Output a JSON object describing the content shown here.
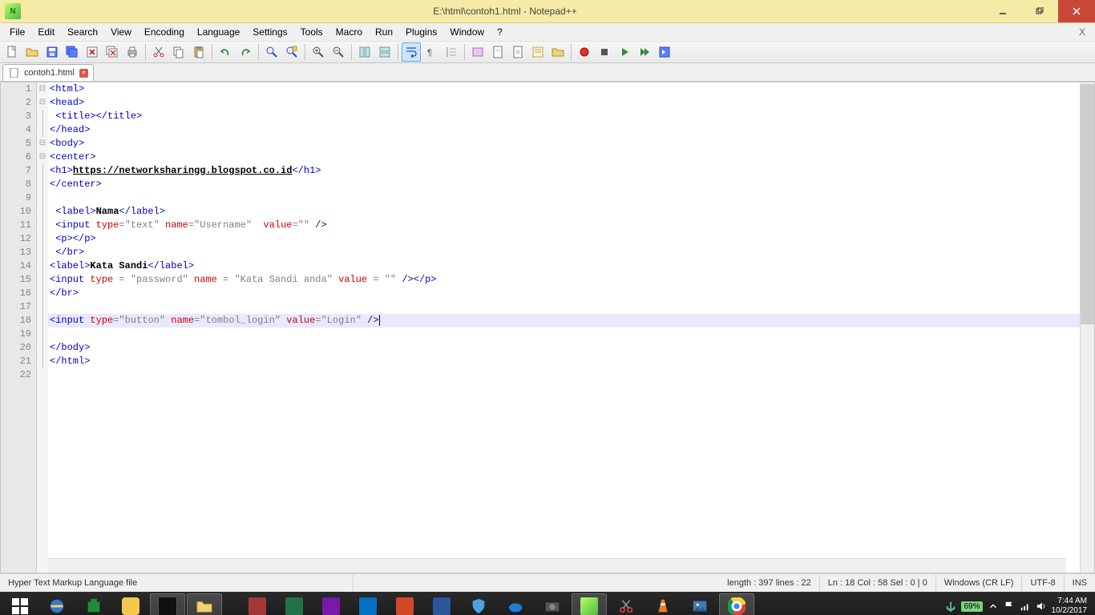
{
  "window": {
    "title": "E:\\html\\contoh1.html - Notepad++",
    "menu": [
      "File",
      "Edit",
      "Search",
      "View",
      "Encoding",
      "Language",
      "Settings",
      "Tools",
      "Macro",
      "Run",
      "Plugins",
      "Window",
      "?"
    ],
    "menu_close": "X"
  },
  "tab": {
    "label": "contoh1.html"
  },
  "lines": {
    "n1": "1",
    "n2": "2",
    "n3": "3",
    "n4": "4",
    "n5": "5",
    "n6": "6",
    "n7": "7",
    "n8": "8",
    "n9": "9",
    "n10": "10",
    "n11": "11",
    "n12": "12",
    "n13": "13",
    "n14": "14",
    "n15": "15",
    "n16": "16",
    "n17": "17",
    "n18": "18",
    "n19": "19",
    "n20": "20",
    "n21": "21",
    "n22": "22"
  },
  "code": {
    "l1": {
      "a": "<html>"
    },
    "l2": {
      "a": "<head>"
    },
    "l3": {
      "a": " <title>",
      "b": "</title>"
    },
    "l4": {
      "a": "</head>"
    },
    "l5": {
      "a": "<body>"
    },
    "l6": {
      "a": "<center>"
    },
    "l7": {
      "a": "<h1>",
      "b": "https://networksharingg.blogspot.co.id",
      "c": "</h1>"
    },
    "l8": {
      "a": "</center>"
    },
    "l10": {
      "a": " <label>",
      "b": "Nama",
      "c": "</label>"
    },
    "l11": {
      "a": " <input ",
      "b": "type",
      "c": "=\"text\"",
      "d": " name",
      "e": "=\"Username\"",
      "f": "  value",
      "g": "=\"\"",
      "h": " />"
    },
    "l12": {
      "a": " <p>",
      "b": "</p>"
    },
    "l13": {
      "a": " </br>"
    },
    "l14": {
      "a": "<label>",
      "b": "Kata Sandi",
      "c": "</label>"
    },
    "l15": {
      "a": "<input ",
      "b": "type",
      "c": " = \"password\"",
      "d": " name",
      "e": " = \"Kata Sandi anda\"",
      "f": " value",
      "g": " = \"\"",
      "h": " />",
      "i": "</p>"
    },
    "l16": {
      "a": "</br>"
    },
    "l18": {
      "a": "<input ",
      "b": "type",
      "c": "=\"button\"",
      "d": " name",
      "e": "=\"tombol_login\"",
      "f": " value",
      "g": "=\"Login\"",
      "h": " />"
    },
    "l20": {
      "a": "</body>"
    },
    "l21": {
      "a": "</html>"
    }
  },
  "status": {
    "filetype": "Hyper Text Markup Language file",
    "length": "length : 397    lines : 22",
    "pos": "Ln : 18    Col : 58    Sel : 0 | 0",
    "eol": "Windows (CR LF)",
    "enc": "UTF-8",
    "ins": "INS"
  },
  "tray": {
    "battery": "69%",
    "time": "7:44 AM",
    "date": "10/2/2017"
  }
}
